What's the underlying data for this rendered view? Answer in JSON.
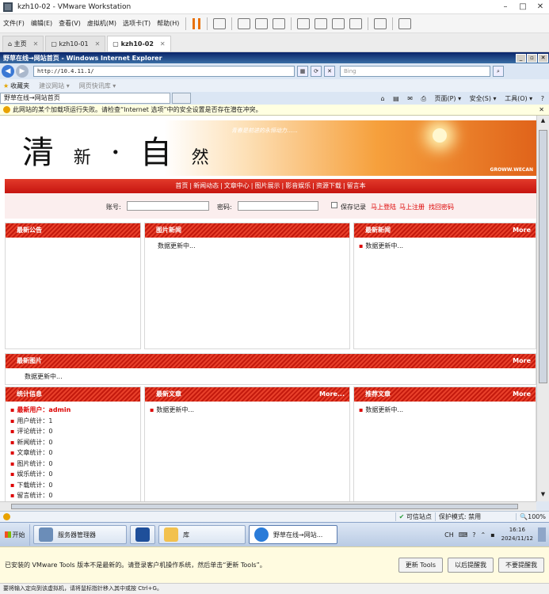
{
  "vmware": {
    "title": "kzh10-02 - VMware Workstation",
    "menu": [
      "文件(F)",
      "编辑(E)",
      "查看(V)",
      "虚拟机(M)",
      "选项卡(T)",
      "帮助(H)"
    ],
    "tabs": [
      {
        "label": "主页"
      },
      {
        "label": "kzh10-01"
      },
      {
        "label": "kzh10-02"
      }
    ],
    "tools_message": "已安装的 VMware Tools 版本不是最新的。请登录客户机操作系统，然后单击“更新 Tools”。",
    "tools_buttons": [
      "更新 Tools",
      "以后提醒我",
      "不要提醒我"
    ],
    "status_text": "要将输入定向到该虚拟机，请将鼠标指针移入其中或按 Ctrl+G。"
  },
  "ie": {
    "title": "野草在线→网站首页 - Windows Internet Explorer",
    "address": "http://10.4.11.1/",
    "search_placeholder": "Bing",
    "favorites": {
      "label": "收藏夹",
      "items": [
        "建议网站 ▾",
        "网页快讯库 ▾"
      ]
    },
    "tab_label": "野草在线→网站首页",
    "commands": [
      "页面(P) ▾",
      "安全(S) ▾",
      "工具(O) ▾"
    ],
    "infobar": "此网站的某个加载项运行失败。请检查“Internet 选项”中的安全设置是否存在潜在冲突。",
    "status": {
      "zone": "可信站点",
      "protected": "保护模式: 禁用",
      "zoom": "100%"
    }
  },
  "site": {
    "logo_chars": [
      "清",
      "新",
      "·",
      "自",
      "然"
    ],
    "slogan": "青春是前进的永恒动力……",
    "watermark": "GROWW.WECAN",
    "nav": [
      "首页",
      "新闻动态",
      "文章中心",
      "图片展示",
      "影音娱乐",
      "资源下载",
      "留言本"
    ],
    "login": {
      "account_label": "账号:",
      "password_label": "密码:",
      "remember": "保存记录",
      "login_link": "马上登陆",
      "register_link": "马上注册",
      "recover_link": "找回密码"
    },
    "panels": {
      "notice": {
        "title": "最新公告"
      },
      "pic_news": {
        "title": "图片新闻",
        "body": "数据更新中..."
      },
      "latest_news": {
        "title": "最新新闻",
        "more": "More",
        "body": "数据更新中..."
      },
      "latest_pics": {
        "title": "最新图片",
        "more": "More",
        "body": "数据更新中..."
      },
      "stats": {
        "title": "统计信息",
        "newest_user_label": "最新用户：",
        "newest_user": "admin",
        "rows": [
          "用户统计：1",
          "评论统计：0",
          "新闻统计：0",
          "文章统计：0",
          "图片统计：0",
          "娱乐统计：0",
          "下载统计：0",
          "留言统计：0"
        ]
      },
      "latest_articles": {
        "title": "最新文章",
        "more": "More...",
        "body": "数据更新中..."
      },
      "recommended": {
        "title": "推荐文章",
        "more": "More",
        "body": "数据更新中..."
      }
    }
  },
  "taskbar": {
    "start": "开始",
    "items": [
      "服务器管理器",
      "库",
      "野草在线→网站..."
    ],
    "lang": "CH",
    "time": "16:16",
    "date": "2024/11/12"
  },
  "colors": {
    "accent_red": "#c61410",
    "vm_orange": "#e8710a",
    "ie_blue": "#0a246a"
  }
}
